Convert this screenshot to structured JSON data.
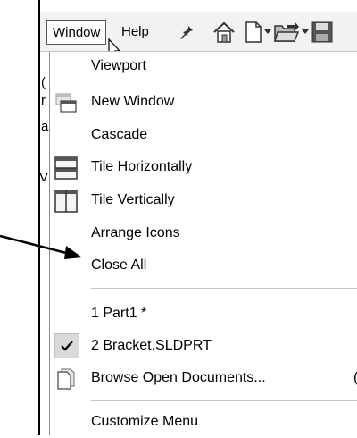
{
  "menubar": {
    "items": [
      {
        "label": "Window",
        "active": true
      },
      {
        "label": "Help",
        "active": false
      }
    ],
    "pin_icon": "pin-icon",
    "toolbar_icons": [
      "home-icon",
      "new-document-icon",
      "open-folder-icon",
      "save-icon"
    ]
  },
  "menu": {
    "items": [
      {
        "label": "Viewport",
        "icon": null
      },
      {
        "label": "New Window",
        "icon": "new-window-icon"
      },
      {
        "label": "Cascade",
        "icon": null
      },
      {
        "label": "Tile Horizontally",
        "icon": "tile-horizontally-icon"
      },
      {
        "label": "Tile Vertically",
        "icon": "tile-vertically-icon"
      },
      {
        "label": "Arrange Icons",
        "icon": null
      },
      {
        "label": "Close All",
        "icon": null
      }
    ],
    "documents": [
      {
        "label": "1 Part1 *",
        "checked": false
      },
      {
        "label": "2 Bracket.SLDPRT",
        "checked": true
      },
      {
        "label": "Browse Open Documents...",
        "icon": "browse-documents-icon",
        "shortcut": "("
      }
    ],
    "customize": {
      "label": "Customize Menu"
    }
  },
  "background_fragments": [
    "(",
    "r",
    "a",
    "V"
  ],
  "annotation": {
    "type": "arrow",
    "points_to": "Close All"
  },
  "colors": {
    "menubar_bg": "#f2f2f2",
    "menu_bg": "#ffffff",
    "check_bg": "#d9d9d9",
    "separator": "#c6c6c6"
  }
}
